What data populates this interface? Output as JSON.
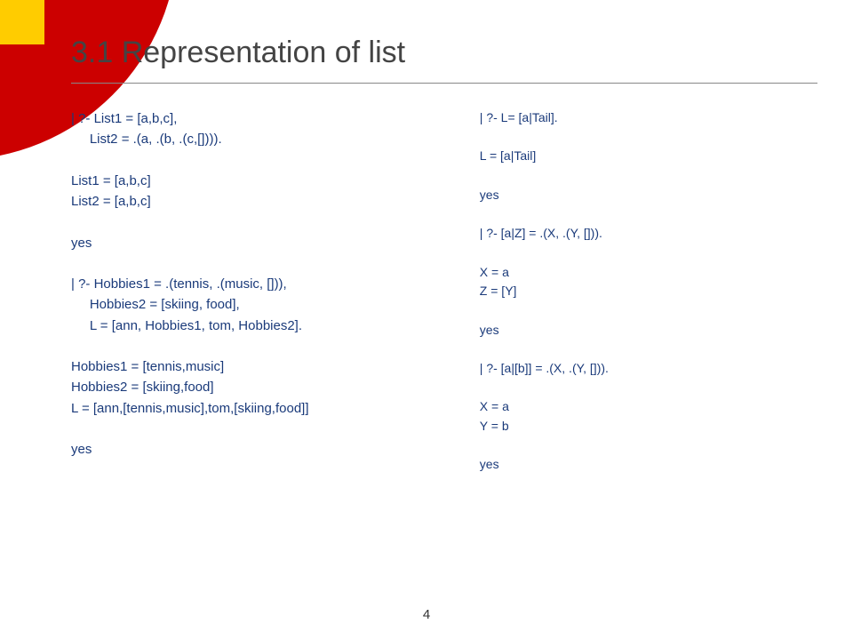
{
  "title": "3.1 Representation of list",
  "left_code": "| ?- List1 = [a,b,c],\n     List2 = .(a, .(b, .(c,[]))).\n\nList1 = [a,b,c]\nList2 = [a,b,c]\n\nyes\n\n| ?- Hobbies1 = .(tennis, .(music, [])),\n     Hobbies2 = [skiing, food],\n     L = [ann, Hobbies1, tom, Hobbies2].\n\nHobbies1 = [tennis,music]\nHobbies2 = [skiing,food]\nL = [ann,[tennis,music],tom,[skiing,food]]\n\nyes",
  "right_code": "| ?- L= [a|Tail].\n\nL = [a|Tail]\n\nyes\n\n| ?- [a|Z] = .(X, .(Y, [])).\n\nX = a\nZ = [Y]\n\nyes\n\n| ?- [a|[b]] = .(X, .(Y, [])).\n\nX = a\nY = b\n\nyes",
  "page_number": "4"
}
